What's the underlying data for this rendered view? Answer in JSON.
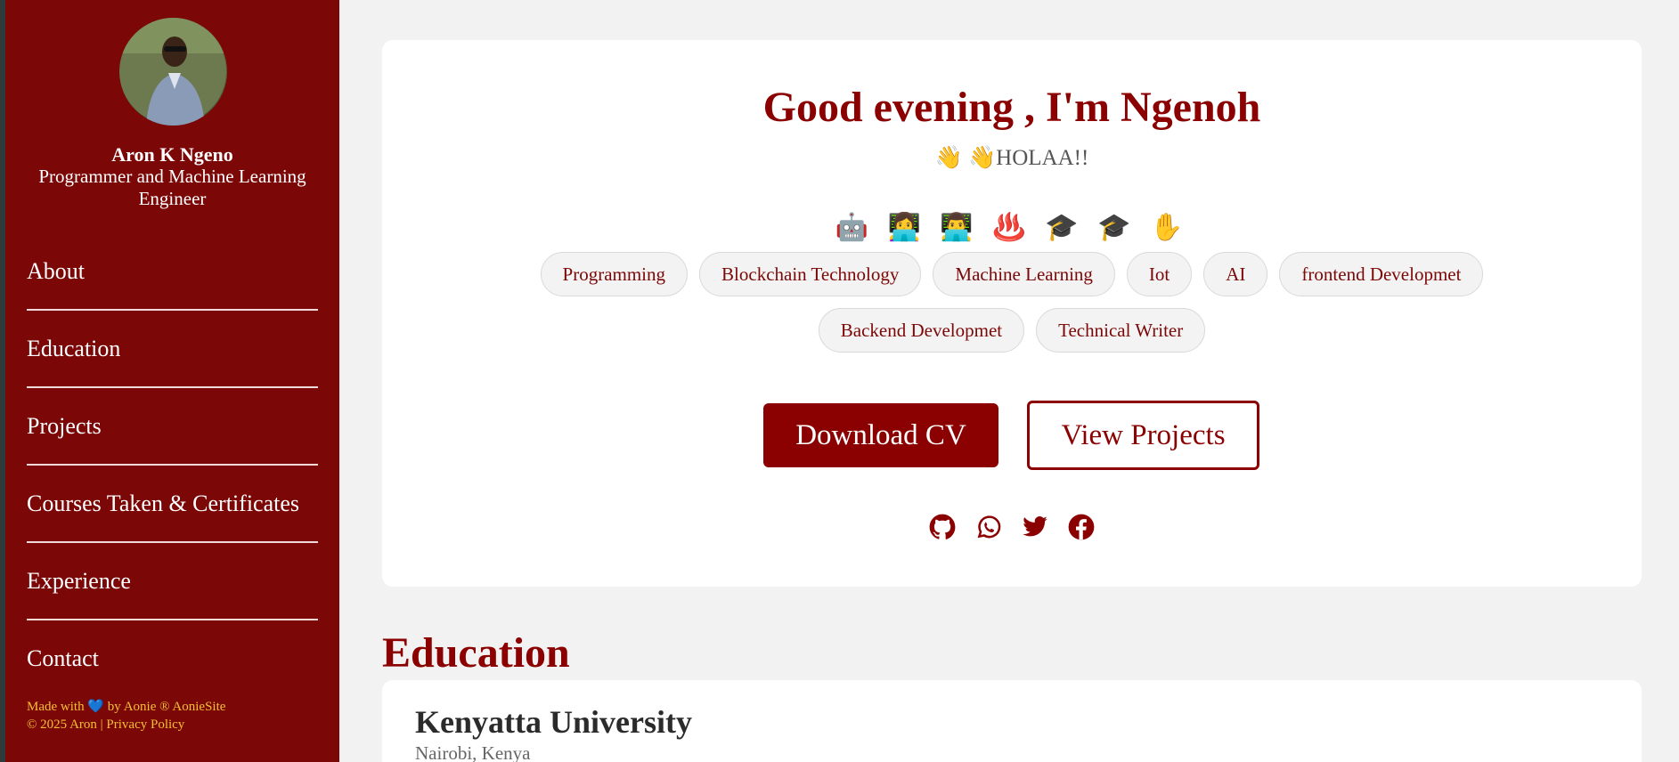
{
  "profile": {
    "name": "Aron K Ngeno",
    "role": "Programmer and Machine Learning Engineer"
  },
  "nav": {
    "items": [
      {
        "label": "About"
      },
      {
        "label": "Education"
      },
      {
        "label": "Projects"
      },
      {
        "label": "Courses Taken & Certificates"
      },
      {
        "label": "Experience"
      },
      {
        "label": "Contact"
      }
    ]
  },
  "footer": {
    "made_with_prefix": "Made with",
    "made_with_suffix": "by Aonie ® AonieSite",
    "copyright": "© 2025 Aron | ",
    "privacy": "Privacy Policy"
  },
  "hero": {
    "greeting": "Good evening , I'm Ngenoh",
    "hello": "👋 👋HOLAA!!",
    "emojis": "🤖 👩‍💻 👨‍💻 ♨️ 🎓 🎓 ✋",
    "tags": [
      "Programming",
      "Blockchain Technology",
      "Machine Learning",
      "Iot",
      "AI",
      "frontend Developmet",
      "Backend Developmet",
      "Technical Writer"
    ],
    "download_cv": "Download CV",
    "view_projects": "View Projects"
  },
  "socials": [
    "github-icon",
    "whatsapp-icon",
    "twitter-icon",
    "facebook-icon"
  ],
  "education": {
    "section_title": "Education",
    "institution": "Kenyatta University",
    "location": "Nairobi, Kenya"
  },
  "colors": {
    "brand": "#8b0000",
    "sidebar": "#7b0707",
    "footer_text": "#f2c033"
  }
}
